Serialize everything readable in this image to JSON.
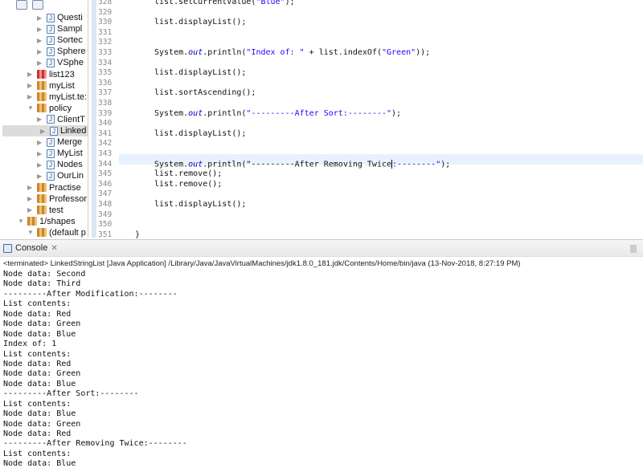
{
  "tree": {
    "items": [
      {
        "label": "Questi",
        "kind": "java",
        "indent": 3
      },
      {
        "label": "Sampl",
        "kind": "java",
        "indent": 3
      },
      {
        "label": "Sortec",
        "kind": "java",
        "indent": 3
      },
      {
        "label": "Sphere",
        "kind": "java",
        "indent": 3
      },
      {
        "label": "VSphe",
        "kind": "java",
        "indent": 3
      },
      {
        "label": "list123",
        "kind": "pkg-error",
        "indent": 2
      },
      {
        "label": "myList",
        "kind": "pkg",
        "indent": 2
      },
      {
        "label": "myList.te:",
        "kind": "pkg",
        "indent": 2
      },
      {
        "label": "policy",
        "kind": "pkg",
        "indent": 2,
        "expanded": true
      },
      {
        "label": "ClientT",
        "kind": "java",
        "indent": 3
      },
      {
        "label": "Linked",
        "kind": "java",
        "indent": 3,
        "selected": true
      },
      {
        "label": "Merge",
        "kind": "java",
        "indent": 3
      },
      {
        "label": "MyList",
        "kind": "java",
        "indent": 3
      },
      {
        "label": "Nodes",
        "kind": "java",
        "indent": 3
      },
      {
        "label": "OurLin",
        "kind": "java",
        "indent": 3
      },
      {
        "label": "Practise",
        "kind": "pkg",
        "indent": 2
      },
      {
        "label": "Professor",
        "kind": "pkg",
        "indent": 2
      },
      {
        "label": "test",
        "kind": "pkg",
        "indent": 2
      },
      {
        "label": "1/shapes",
        "kind": "project",
        "indent": 1,
        "expanded": true
      },
      {
        "label": "(default p",
        "kind": "pkg",
        "indent": 2,
        "expanded": true
      }
    ]
  },
  "editor": {
    "current_line": 344,
    "lines": [
      {
        "n": "328",
        "code": "list.setCurrentValue(\"Blue\");"
      },
      {
        "n": "329",
        "code": ""
      },
      {
        "n": "330",
        "code": "list.displayList();"
      },
      {
        "n": "331",
        "code": ""
      },
      {
        "n": "332",
        "code": ""
      },
      {
        "n": "333",
        "code": "System.out.println(\"Index of: \" + list.indexOf(\"Green\"));"
      },
      {
        "n": "334",
        "code": ""
      },
      {
        "n": "335",
        "code": "list.displayList();"
      },
      {
        "n": "336",
        "code": ""
      },
      {
        "n": "337",
        "code": "list.sortAscending();"
      },
      {
        "n": "338",
        "code": ""
      },
      {
        "n": "339",
        "code": "System.out.println(\"---------After Sort:--------\");"
      },
      {
        "n": "340",
        "code": ""
      },
      {
        "n": "341",
        "code": "list.displayList();"
      },
      {
        "n": "342",
        "code": ""
      },
      {
        "n": "343",
        "code": ""
      },
      {
        "n": "344",
        "code": "System.out.println(\"---------After Removing Twice:--------\");"
      },
      {
        "n": "345",
        "code": "list.remove();"
      },
      {
        "n": "346",
        "code": "list.remove();"
      },
      {
        "n": "347",
        "code": ""
      },
      {
        "n": "348",
        "code": "list.displayList();"
      },
      {
        "n": "349",
        "code": ""
      },
      {
        "n": "350",
        "code": ""
      },
      {
        "n": "351",
        "code": "}"
      }
    ]
  },
  "console": {
    "tab_label": "Console",
    "close_icon": "close-x-icon",
    "status": "<terminated> LinkedStringList [Java Application] /Library/Java/JavaVirtualMachines/jdk1.8.0_181.jdk/Contents/Home/bin/java (13-Nov-2018, 8:27:19 PM)",
    "output": [
      "Node data: Second",
      "Node data: Third",
      "---------After Modification:--------",
      "List contents:",
      "Node data: Red",
      "Node data: Green",
      "Node data: Blue",
      "Index of: 1",
      "List contents:",
      "Node data: Red",
      "Node data: Green",
      "Node data: Blue",
      "---------After Sort:--------",
      "List contents:",
      "Node data: Blue",
      "Node data: Green",
      "Node data: Red",
      "---------After Removing Twice:--------",
      "List contents:",
      "Node data: Blue"
    ]
  }
}
